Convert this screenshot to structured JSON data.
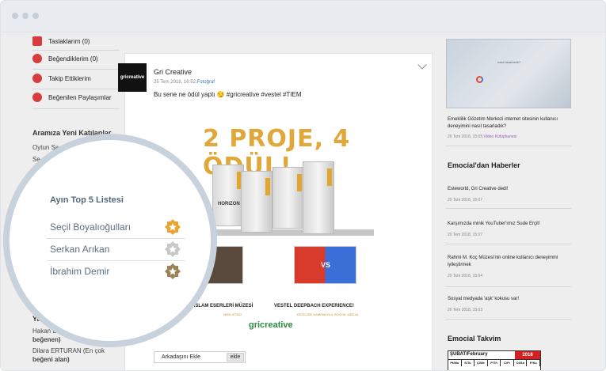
{
  "sidebar": {
    "items": [
      {
        "label": "Taslaklarım (0)",
        "icon": "comment-icon"
      },
      {
        "label": "Beğendiklerim (0)",
        "icon": "heart-icon"
      },
      {
        "label": "Takip Ettiklerim",
        "icon": "target-icon"
      },
      {
        "label": "Beğenilen Paylaşımlar",
        "icon": "star-icon"
      }
    ],
    "new_members_title": "Aramıza Yeni Katılanlar",
    "new_members": [
      "Oytun Sa",
      "Se"
    ],
    "bottom_partial": "Ya",
    "bottom_names": [
      "Hakan E",
      "beğenen)",
      "Dilara ERTURAN (En çok",
      "beğeni alan)"
    ]
  },
  "post": {
    "author": "Gri Creative",
    "avatar_text": "gricreative",
    "date": "25 Tem 2018, 16:52,",
    "category": "Fotoğraf",
    "text": "Bu sene ne ödül yaptı 😏 #gricreative #vestel #TIEM",
    "banner_title": "2 PROJE, 4 ÖDÜL!",
    "trophy_label": "HORIZON",
    "project1_caption": "E İSLAM ESERLERİ MÜZESİ",
    "project1_sub": "WEB SİTESİ",
    "project2_caption": "VESTEL DEEPBACH EXPERIENCE!",
    "project2_sub": "ENTEGRE KAMPANYA & SOSYAL MEDYA",
    "vs_label": "VS",
    "brand": "gricreative",
    "add_friend_label": "Arkadaşını Ekle",
    "add_friend_button": "ekle"
  },
  "right": {
    "video_title": "nasıl tasarladık?",
    "video_caption": "Emeklilik Gözetim Merkezi internet sitesinin kullanıcı deneyimini nasıl tasarladık?",
    "video_date": "26 Tem 2018, 15:05,",
    "video_category": "Video Kütüphanesi",
    "news_title": "Emocial'dan Haberler",
    "news": [
      {
        "text": "Esteworld, Gri Creative dedi!",
        "date": "20 Tem 2018, 15:07"
      },
      {
        "text": "Karşımızda minik YouTuber'ımız Sude Erçit!",
        "date": "20 Tem 2018, 15:07"
      },
      {
        "text": "Rahmi M. Koç Müzesi'nin online kullanıcı deneyimini iyileştirmek",
        "date": "20 Tem 2018, 15:04"
      },
      {
        "text": "Sosyal medyada 'aşk' kokusu var!",
        "date": "20 Tem 2018, 15:03"
      }
    ],
    "calendar_title": "Emocial Takvim",
    "calendar_month": "ŞUBAT/February",
    "calendar_year": "2018",
    "calendar_days": [
      "Pt/Mo",
      "S/Tu",
      "Ç/We",
      "P/Th",
      "C/Fr",
      "Ct/Sa",
      "P/Su"
    ]
  },
  "top5": {
    "title": "Ayın Top 5 Listesi",
    "entries": [
      {
        "name": "Seçil Boyalıoğulları",
        "badge": "gold-star-badge-icon"
      },
      {
        "name": "Serkan Arıkan",
        "badge": "silver-star-badge-icon"
      },
      {
        "name": "İbrahim Demir",
        "badge": "bronze-star-badge-icon"
      }
    ]
  },
  "colors": {
    "accent_red": "#d93c3c",
    "gold": "#e9a534",
    "silver": "#c8c8c8",
    "bronze": "#9c8257",
    "magnifier_ring": "#c7d2dc"
  }
}
